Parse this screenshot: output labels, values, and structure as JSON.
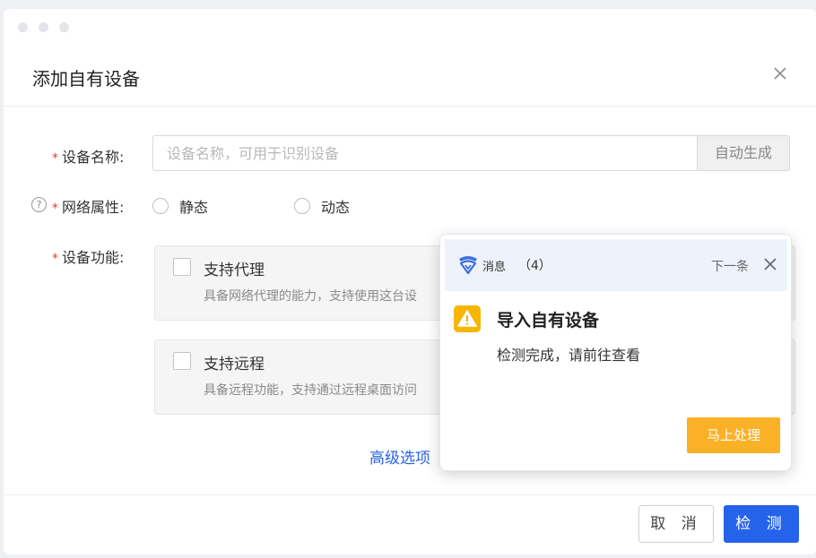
{
  "dialog": {
    "title": "添加自有设备",
    "fields": {
      "name": {
        "label": "设备名称:",
        "placeholder": "设备名称，可用于识别设备",
        "value": "",
        "gen_button": "自动生成"
      },
      "network": {
        "label": "网络属性:",
        "options": [
          "静态",
          "动态"
        ]
      },
      "features": {
        "label": "设备功能:",
        "items": [
          {
            "title": "支持代理",
            "desc": "具备网络代理的能力，支持使用这台设"
          },
          {
            "title": "支持远程",
            "desc": "具备远程功能，支持通过远程桌面访问"
          }
        ]
      }
    },
    "advanced_link": "高级选项",
    "footer": {
      "cancel": "取 消",
      "confirm": "检 测"
    }
  },
  "notification": {
    "app_name": "消息",
    "count": "（4）",
    "next_label": "下一条",
    "title": "导入自有设备",
    "text": "检测完成，请前往查看",
    "action": "马上处理"
  },
  "colors": {
    "primary": "#2563eb",
    "required": "#e53935",
    "warning": "#f7b500",
    "action": "#fbb126"
  }
}
